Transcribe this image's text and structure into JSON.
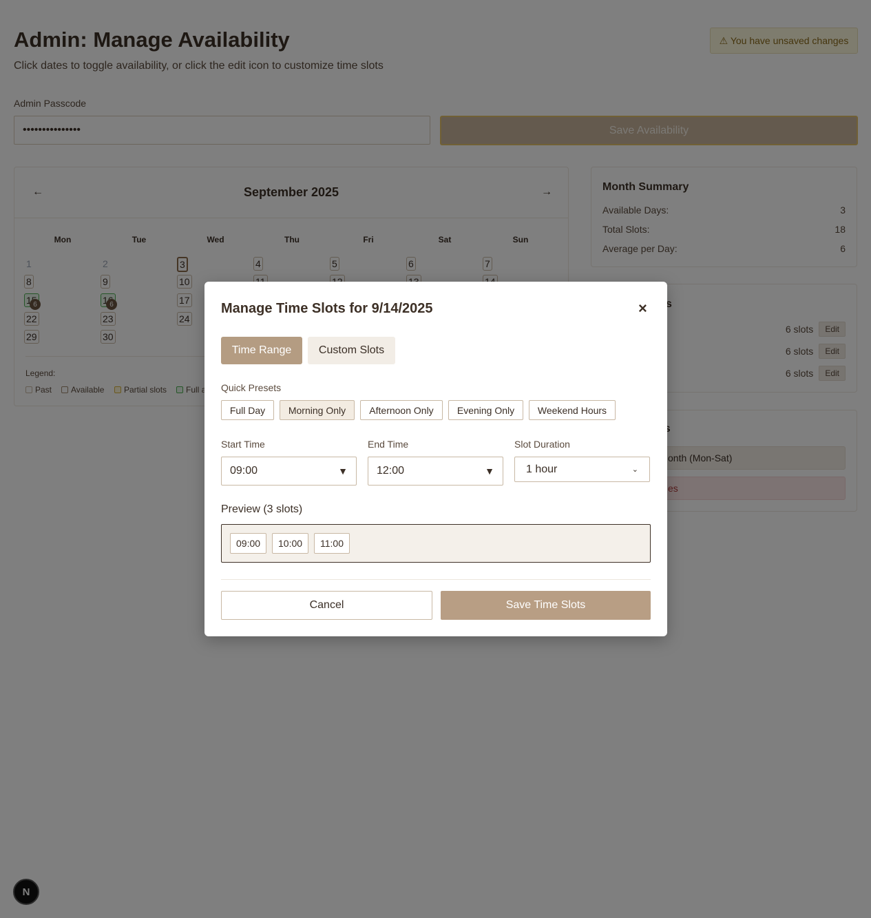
{
  "header": {
    "title": "Admin: Manage Availability",
    "subtitle": "Click dates to toggle availability, or click the edit icon to customize time slots",
    "unsaved": "⚠ You have unsaved changes"
  },
  "passcode": {
    "label": "Admin Passcode",
    "value": "•••••••••••••••"
  },
  "save_availability": "Save Availability",
  "calendar": {
    "prev": "←",
    "next": "→",
    "month": "September 2025",
    "weekdays": [
      "Mon",
      "Tue",
      "Wed",
      "Thu",
      "Fri",
      "Sat",
      "Sun"
    ],
    "days": [
      "1",
      "2",
      "3",
      "4",
      "5",
      "6",
      "7",
      "8",
      "9",
      "10",
      "11",
      "12",
      "13",
      "14",
      "15",
      "16",
      "17",
      "22",
      "23",
      "24",
      "29",
      "30"
    ],
    "slot_badges": [
      "6",
      "6"
    ],
    "legend_label": "Legend:",
    "legend": [
      "Past",
      "Available",
      "Partial slots",
      "Full a"
    ]
  },
  "summary": {
    "title": "Month Summary",
    "rows": [
      {
        "label": "Available Days:",
        "value": "3"
      },
      {
        "label": "Total Slots:",
        "value": "18"
      },
      {
        "label": "Average per Day:",
        "value": "6"
      }
    ]
  },
  "scheduled": {
    "title_fragment": "s",
    "rows": [
      {
        "slots": "6 slots",
        "edit": "Edit"
      },
      {
        "slots": "6 slots",
        "edit": "Edit"
      },
      {
        "slots": "6 slots",
        "edit": "Edit"
      }
    ]
  },
  "quick_actions": {
    "title_fragment": "ns",
    "action1": "onth (Mon-Sat)",
    "action2": "es"
  },
  "modal": {
    "title": "Manage Time Slots for 9/14/2025",
    "close": "×",
    "tabs": [
      "Time Range",
      "Custom Slots"
    ],
    "quick_presets_label": "Quick Presets",
    "presets": [
      "Full Day",
      "Morning Only",
      "Afternoon Only",
      "Evening Only",
      "Weekend Hours"
    ],
    "start_label": "Start Time",
    "start_value": "09:00",
    "end_label": "End Time",
    "end_value": "12:00",
    "duration_label": "Slot Duration",
    "duration_value": "1 hour",
    "preview_label": "Preview (3 slots)",
    "preview_slots": [
      "09:00",
      "10:00",
      "11:00"
    ],
    "cancel": "Cancel",
    "save": "Save Time Slots"
  },
  "next_badge": "N"
}
